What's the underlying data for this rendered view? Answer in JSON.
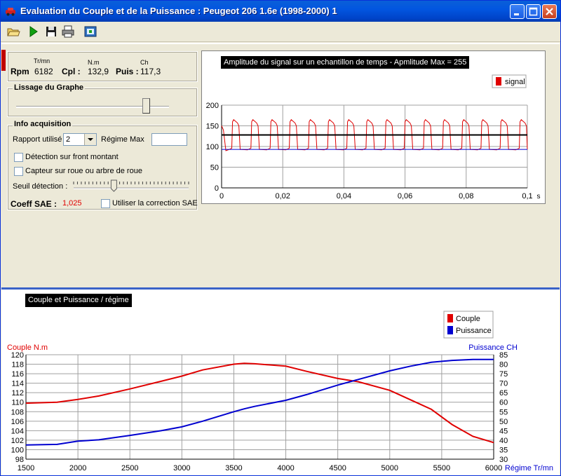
{
  "window": {
    "title": "Evaluation du Couple et de la Puissance : Peugeot 206 1.6e (1998-2000) 1"
  },
  "toolbar": {
    "buttons": [
      "open-folder-icon",
      "play-icon",
      "save-disk-icon",
      "print-icon",
      "export-icon"
    ]
  },
  "readout": {
    "rpm_label": "Rpm",
    "rpm_unit": "Tr/mn",
    "rpm_value": "6182",
    "cpl_label": "Cpl :",
    "cpl_unit": "N.m",
    "cpl_value": "132,9",
    "puis_label": "Puis :",
    "puis_unit": "Ch",
    "puis_value": "117,3"
  },
  "lissage": {
    "title": "Lissage du Graphe",
    "slider_value": 0.85
  },
  "acquisition": {
    "title": "Info acquisition",
    "rapport_label": "Rapport utilisé",
    "rapport_value": "2",
    "regime_max_label": "Régime Max",
    "regime_max_value": "",
    "front_montant_label": "Détection sur front montant",
    "capteur_label": "Capteur sur roue ou arbre de roue",
    "seuil_label": "Seuil détection :",
    "seuil_value": 0.35,
    "coeff_label": "Coeff SAE :",
    "coeff_value": "1,025",
    "correction_label": "Utiliser la correction SAE"
  },
  "colors": {
    "red": "#e00000",
    "blue": "#0000d0",
    "coeff": "#e00000"
  },
  "chart_data": [
    {
      "type": "line",
      "title": "Amplitude du signal sur un echantillon de temps - Apmlitude Max = 255",
      "xlabel": "s",
      "ylabel": "",
      "xlim": [
        0,
        0.1
      ],
      "ylim": [
        0,
        200
      ],
      "x_ticks": [
        "0",
        "0,02",
        "0,04",
        "0,06",
        "0,08",
        "0,1"
      ],
      "y_ticks": [
        "0",
        "50",
        "100",
        "150",
        "200"
      ],
      "legend": "top-right",
      "series": [
        {
          "name": "signal",
          "color": "#e00000",
          "pattern": "square-wave",
          "high": 165,
          "low": 90,
          "cycles": 16
        }
      ],
      "reference_lines": [
        {
          "value": 128,
          "color": "#000000"
        },
        {
          "value": 93,
          "color": "#0000d0"
        }
      ],
      "grid": true
    },
    {
      "type": "line",
      "title": "Couple et Puissance / régime",
      "xlabel": "Régime Tr/mn",
      "ylabel_left": "Couple N.m",
      "ylabel_right": "Puissance CH",
      "xlim": [
        1500,
        6000
      ],
      "ylim_left": [
        98,
        120
      ],
      "ylim_right": [
        30,
        85
      ],
      "x_ticks": [
        "1500",
        "2000",
        "2500",
        "3000",
        "3500",
        "4000",
        "4500",
        "5000",
        "5500",
        "6000"
      ],
      "y_ticks_left": [
        "98",
        "100",
        "102",
        "104",
        "106",
        "108",
        "110",
        "112",
        "114",
        "116",
        "118",
        "120"
      ],
      "y_ticks_right": [
        "30",
        "35",
        "40",
        "45",
        "50",
        "55",
        "60",
        "65",
        "70",
        "75",
        "80",
        "85"
      ],
      "legend": "top-right",
      "grid": true,
      "x": [
        1500,
        1800,
        2000,
        2200,
        2500,
        2800,
        3000,
        3200,
        3500,
        3600,
        3700,
        4000,
        4200,
        4500,
        4700,
        5000,
        5200,
        5400,
        5600,
        5800,
        6000
      ],
      "series": [
        {
          "name": "Couple",
          "axis": "left",
          "color": "#e00000",
          "values": [
            109.8,
            110.0,
            110.6,
            111.3,
            112.8,
            114.4,
            115.5,
            116.8,
            118.0,
            118.2,
            118.1,
            117.6,
            116.5,
            115.0,
            114.3,
            112.5,
            110.5,
            108.5,
            105.3,
            102.8,
            101.5
          ]
        },
        {
          "name": "Puissance",
          "axis": "right",
          "color": "#0000d0",
          "values": [
            37.5,
            37.8,
            39.5,
            40.2,
            42.5,
            45.0,
            47.0,
            50.0,
            55.0,
            56.5,
            57.8,
            61.0,
            64.0,
            69.0,
            72.0,
            76.5,
            79.0,
            81.0,
            82.0,
            82.5,
            82.5
          ]
        }
      ]
    }
  ]
}
